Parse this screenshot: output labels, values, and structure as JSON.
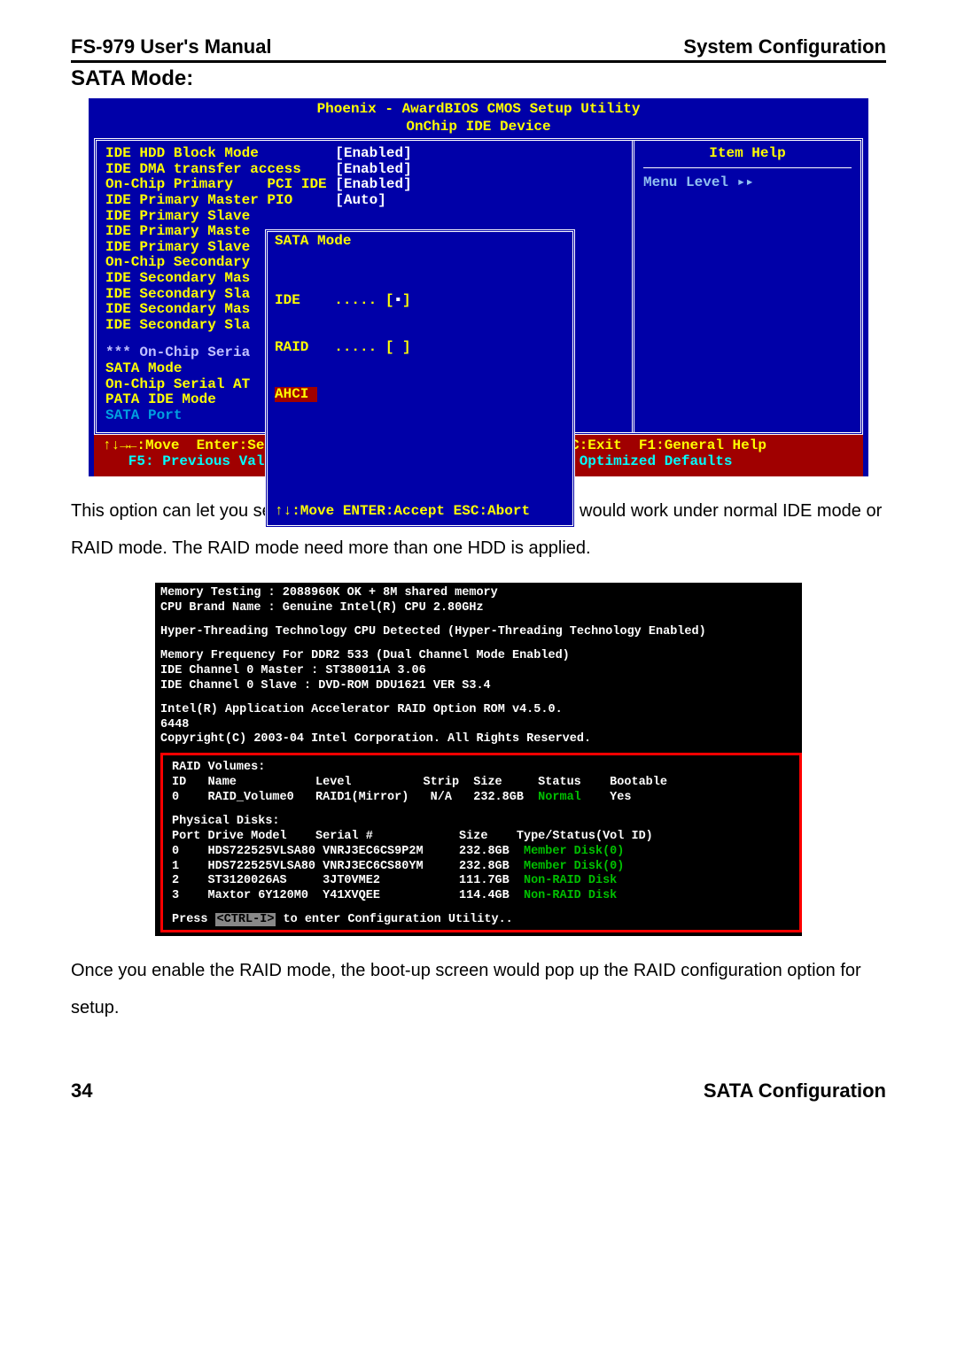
{
  "header": {
    "left": "FS-979 User's Manual",
    "right": "System Configuration"
  },
  "section_title": "SATA Mode:",
  "bios": {
    "title": "Phoenix - AwardBIOS CMOS Setup Utility",
    "subtitle": "OnChip IDE Device",
    "settings": [
      {
        "label": "IDE HDD Block Mode         ",
        "value": "[Enabled]"
      },
      {
        "label": "IDE DMA transfer access    ",
        "value": "[Enabled]"
      },
      {
        "label": "On-Chip Primary    PCI IDE ",
        "value": "[Enabled]"
      },
      {
        "label": "IDE Primary Master PIO     ",
        "value": "[Auto]"
      },
      {
        "label": "IDE Primary Slave",
        "value": ""
      },
      {
        "label": "IDE Primary Maste",
        "value": ""
      },
      {
        "label": "IDE Primary Slave",
        "value": ""
      },
      {
        "label": "On-Chip Secondary",
        "value": ""
      },
      {
        "label": "IDE Secondary Mas",
        "value": ""
      },
      {
        "label": "IDE Secondary Sla",
        "value": ""
      },
      {
        "label": "IDE Secondary Mas",
        "value": ""
      },
      {
        "label": "IDE Secondary Sla",
        "value": ""
      }
    ],
    "serial_header": "*** On-Chip Seria",
    "serial_items": [
      "SATA Mode",
      "On-Chip Serial AT",
      "PATA IDE Mode",
      "SATA Port"
    ],
    "dialog": {
      "title": "SATA Mode",
      "opt_ide": "IDE    ..... [",
      "opt_ide_sel": "▪",
      "opt_ide_end": "]",
      "opt_raid": "RAID   ..... [ ]",
      "opt_ahci": "AHCI ",
      "footer": "↑↓:Move ENTER:Accept ESC:Abort"
    },
    "right": {
      "item_help": "Item Help",
      "menu_level": "Menu Level    ▸▸"
    },
    "footer1": "↑↓→←:Move  Enter:Select  +/-/PU/PD:Value  F10:Save   ESC:Exit  F1:General Help",
    "footer2": "   F5: Previous Values    F6: Fail-Safe Defaults    F7: Optimized Defaults"
  },
  "para1": "This option can let you select whether the Serial ATA hard drives would work under normal IDE mode or RAID mode. The RAID mode need more than one HDD is applied.",
  "post": {
    "mem": "Memory Testing : 2088960K OK +  8M shared memory",
    "cpu": "CPU Brand Name : Genuine Intel(R) CPU 2.80GHz",
    "ht": "Hyper-Threading Technology CPU Detected (Hyper-Threading Technology Enabled)",
    "memfreq": "  Memory Frequency For DDR2 533  (Dual Channel Mode Enabled)",
    "ide0m": "IDE Channel 0 Master : ST380011A 3.06",
    "ide0s": "IDE Channel 0 Slave  : DVD-ROM DDU1621 VER S3.4",
    "accel": "                      Intel(R) Application Accelerator RAID Option ROM v4.5.0.",
    "num": "6448",
    "copyright": "Copyright(C) 2003-04 Intel Corporation.  All Rights Reserved.",
    "raid_volumes_hdr": "RAID Volumes:",
    "raid_vol_cols": "ID   Name           Level          Strip  Size     Status    Bootable",
    "raid_vol_row": "0    RAID_Volume0   RAID1(Mirror)   N/A   232.8GB  Normal    Yes",
    "phys_hdr": "Physical Disks:",
    "phys_cols": "Port Drive Model    Serial #            Size    Type/Status(Vol ID)",
    "phys_rows": [
      "0    HDS722525VLSA80 VNRJ3EC6CS9P2M     232.8GB  Member Disk(0)",
      "1    HDS722525VLSA80 VNRJ3EC6CS80YM     232.8GB  Member Disk(0)",
      "2    ST3120026AS     3JT0VME2           111.7GB  Non-RAID Disk",
      "3    Maxtor 6Y120M0  Y41XVQEE           114.4GB  Non-RAID Disk"
    ],
    "press_pre": "Press ",
    "press_key": "<CTRL-I>",
    "press_post": " to enter Configuration Utility.."
  },
  "para2": "Once you enable the RAID mode, the boot-up screen would pop up the RAID configuration option for setup.",
  "footer": {
    "left": "34",
    "right": "SATA Configuration"
  }
}
